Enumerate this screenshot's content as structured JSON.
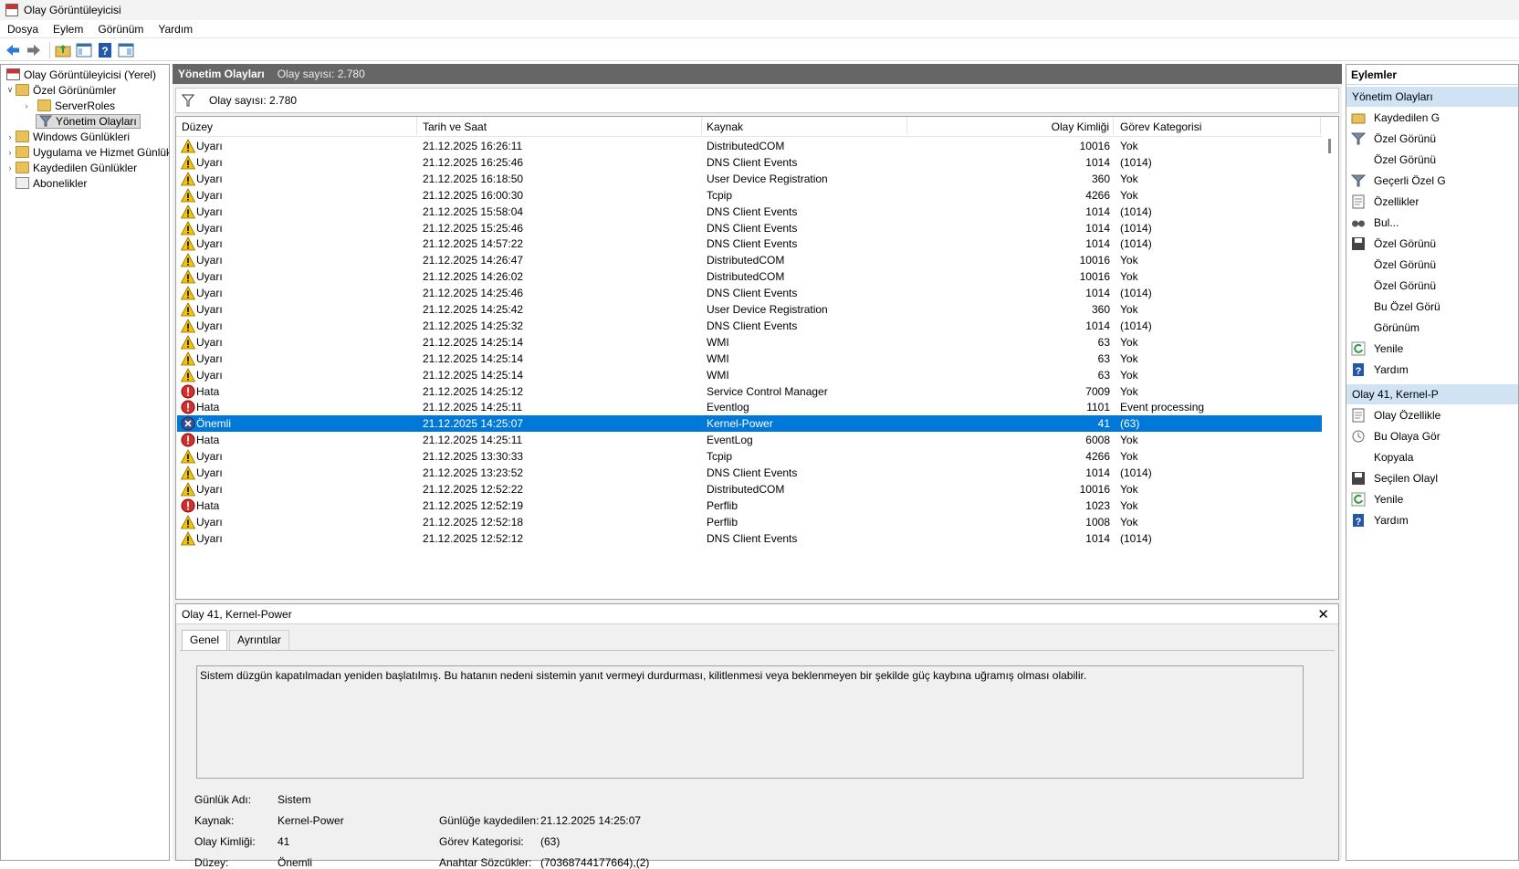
{
  "window": {
    "title": "Olay Görüntüleyicisi"
  },
  "menu": [
    "Dosya",
    "Eylem",
    "Görünüm",
    "Yardım"
  ],
  "tree": {
    "root": "Olay Görüntüleyicisi (Yerel)",
    "custom_views": "Özel Görünümler",
    "server_roles": "ServerRoles",
    "admin_events": "Yönetim Olayları",
    "windows_logs": "Windows Günlükleri",
    "app_service_logs": "Uygulama ve Hizmet Günlükl",
    "saved_logs": "Kaydedilen Günlükler",
    "subscriptions": "Abonelikler"
  },
  "header": {
    "title": "Yönetim Olayları",
    "count": "Olay sayısı: 2.780"
  },
  "filter": {
    "count": "Olay sayısı: 2.780"
  },
  "columns": {
    "level": "Düzey",
    "date": "Tarih ve Saat",
    "source": "Kaynak",
    "event_id": "Olay Kimliği",
    "category": "Görev Kategorisi"
  },
  "events": [
    {
      "level": "Uyarı",
      "kind": "warning",
      "date": "21.12.2025 16:26:11",
      "source": "DistributedCOM",
      "id": "10016",
      "category": "Yok"
    },
    {
      "level": "Uyarı",
      "kind": "warning",
      "date": "21.12.2025 16:25:46",
      "source": "DNS Client Events",
      "id": "1014",
      "category": "(1014)"
    },
    {
      "level": "Uyarı",
      "kind": "warning",
      "date": "21.12.2025 16:18:50",
      "source": "User Device Registration",
      "id": "360",
      "category": "Yok"
    },
    {
      "level": "Uyarı",
      "kind": "warning",
      "date": "21.12.2025 16:00:30",
      "source": "Tcpip",
      "id": "4266",
      "category": "Yok"
    },
    {
      "level": "Uyarı",
      "kind": "warning",
      "date": "21.12.2025 15:58:04",
      "source": "DNS Client Events",
      "id": "1014",
      "category": "(1014)"
    },
    {
      "level": "Uyarı",
      "kind": "warning",
      "date": "21.12.2025 15:25:46",
      "source": "DNS Client Events",
      "id": "1014",
      "category": "(1014)"
    },
    {
      "level": "Uyarı",
      "kind": "warning",
      "date": "21.12.2025 14:57:22",
      "source": "DNS Client Events",
      "id": "1014",
      "category": "(1014)"
    },
    {
      "level": "Uyarı",
      "kind": "warning",
      "date": "21.12.2025 14:26:47",
      "source": "DistributedCOM",
      "id": "10016",
      "category": "Yok"
    },
    {
      "level": "Uyarı",
      "kind": "warning",
      "date": "21.12.2025 14:26:02",
      "source": "DistributedCOM",
      "id": "10016",
      "category": "Yok"
    },
    {
      "level": "Uyarı",
      "kind": "warning",
      "date": "21.12.2025 14:25:46",
      "source": "DNS Client Events",
      "id": "1014",
      "category": "(1014)"
    },
    {
      "level": "Uyarı",
      "kind": "warning",
      "date": "21.12.2025 14:25:42",
      "source": "User Device Registration",
      "id": "360",
      "category": "Yok"
    },
    {
      "level": "Uyarı",
      "kind": "warning",
      "date": "21.12.2025 14:25:32",
      "source": "DNS Client Events",
      "id": "1014",
      "category": "(1014)"
    },
    {
      "level": "Uyarı",
      "kind": "warning",
      "date": "21.12.2025 14:25:14",
      "source": "WMI",
      "id": "63",
      "category": "Yok"
    },
    {
      "level": "Uyarı",
      "kind": "warning",
      "date": "21.12.2025 14:25:14",
      "source": "WMI",
      "id": "63",
      "category": "Yok"
    },
    {
      "level": "Uyarı",
      "kind": "warning",
      "date": "21.12.2025 14:25:14",
      "source": "WMI",
      "id": "63",
      "category": "Yok"
    },
    {
      "level": "Hata",
      "kind": "error",
      "date": "21.12.2025 14:25:12",
      "source": "Service Control Manager",
      "id": "7009",
      "category": "Yok"
    },
    {
      "level": "Hata",
      "kind": "error",
      "date": "21.12.2025 14:25:11",
      "source": "Eventlog",
      "id": "1101",
      "category": "Event processing"
    },
    {
      "level": "Önemli",
      "kind": "critical",
      "date": "21.12.2025 14:25:07",
      "source": "Kernel-Power",
      "id": "41",
      "category": "(63)",
      "selected": true
    },
    {
      "level": "Hata",
      "kind": "error",
      "date": "21.12.2025 14:25:11",
      "source": "EventLog",
      "id": "6008",
      "category": "Yok"
    },
    {
      "level": "Uyarı",
      "kind": "warning",
      "date": "21.12.2025 13:30:33",
      "source": "Tcpip",
      "id": "4266",
      "category": "Yok"
    },
    {
      "level": "Uyarı",
      "kind": "warning",
      "date": "21.12.2025 13:23:52",
      "source": "DNS Client Events",
      "id": "1014",
      "category": "(1014)"
    },
    {
      "level": "Uyarı",
      "kind": "warning",
      "date": "21.12.2025 12:52:22",
      "source": "DistributedCOM",
      "id": "10016",
      "category": "Yok"
    },
    {
      "level": "Hata",
      "kind": "error",
      "date": "21.12.2025 12:52:19",
      "source": "Perflib",
      "id": "1023",
      "category": "Yok"
    },
    {
      "level": "Uyarı",
      "kind": "warning",
      "date": "21.12.2025 12:52:18",
      "source": "Perflib",
      "id": "1008",
      "category": "Yok"
    },
    {
      "level": "Uyarı",
      "kind": "warning",
      "date": "21.12.2025 12:52:12",
      "source": "DNS Client Events",
      "id": "1014",
      "category": "(1014)"
    }
  ],
  "detail": {
    "title": "Olay 41, Kernel-Power",
    "tab_general": "Genel",
    "tab_details": "Ayrıntılar",
    "message": "Sistem düzgün kapatılmadan yeniden başlatılmış. Bu hatanın nedeni sistemin yanıt vermeyi durdurması, kilitlenmesi veya beklenmeyen bir şekilde güç kaybına uğramış olması olabilir.",
    "log_name_label": "Günlük Adı:",
    "log_name": "Sistem",
    "source_label": "Kaynak:",
    "source": "Kernel-Power",
    "event_id_label": "Olay Kimliği:",
    "event_id": "41",
    "level_label": "Düzey:",
    "level": "Önemli",
    "logged_label": "Günlüğe kaydedilen:",
    "logged": "21.12.2025 14:25:07",
    "category_label": "Görev Kategorisi:",
    "category": "(63)",
    "keywords_label": "Anahtar Sözcükler:",
    "keywords": "(70368744177664),(2)"
  },
  "actions": {
    "header": "Eylemler",
    "section1": "Yönetim Olayları",
    "items1": [
      "Kaydedilen G",
      "Özel Görünü",
      "Özel Görünü",
      "Geçerli Özel G",
      "Özellikler",
      "Bul...",
      "Özel Görünü",
      "Özel Görünü",
      "Özel Görünü",
      "Bu Özel Görü",
      "Görünüm",
      "Yenile",
      "Yardım"
    ],
    "section2": "Olay 41, Kernel-P",
    "items2": [
      "Olay Özellikle",
      "Bu Olaya Gör",
      "Kopyala",
      "Seçilen Olayl",
      "Yenile",
      "Yardım"
    ]
  },
  "colors": {
    "selection": "#0078d7",
    "header_bg": "#666666",
    "section_bg": "#cfe3f5"
  }
}
